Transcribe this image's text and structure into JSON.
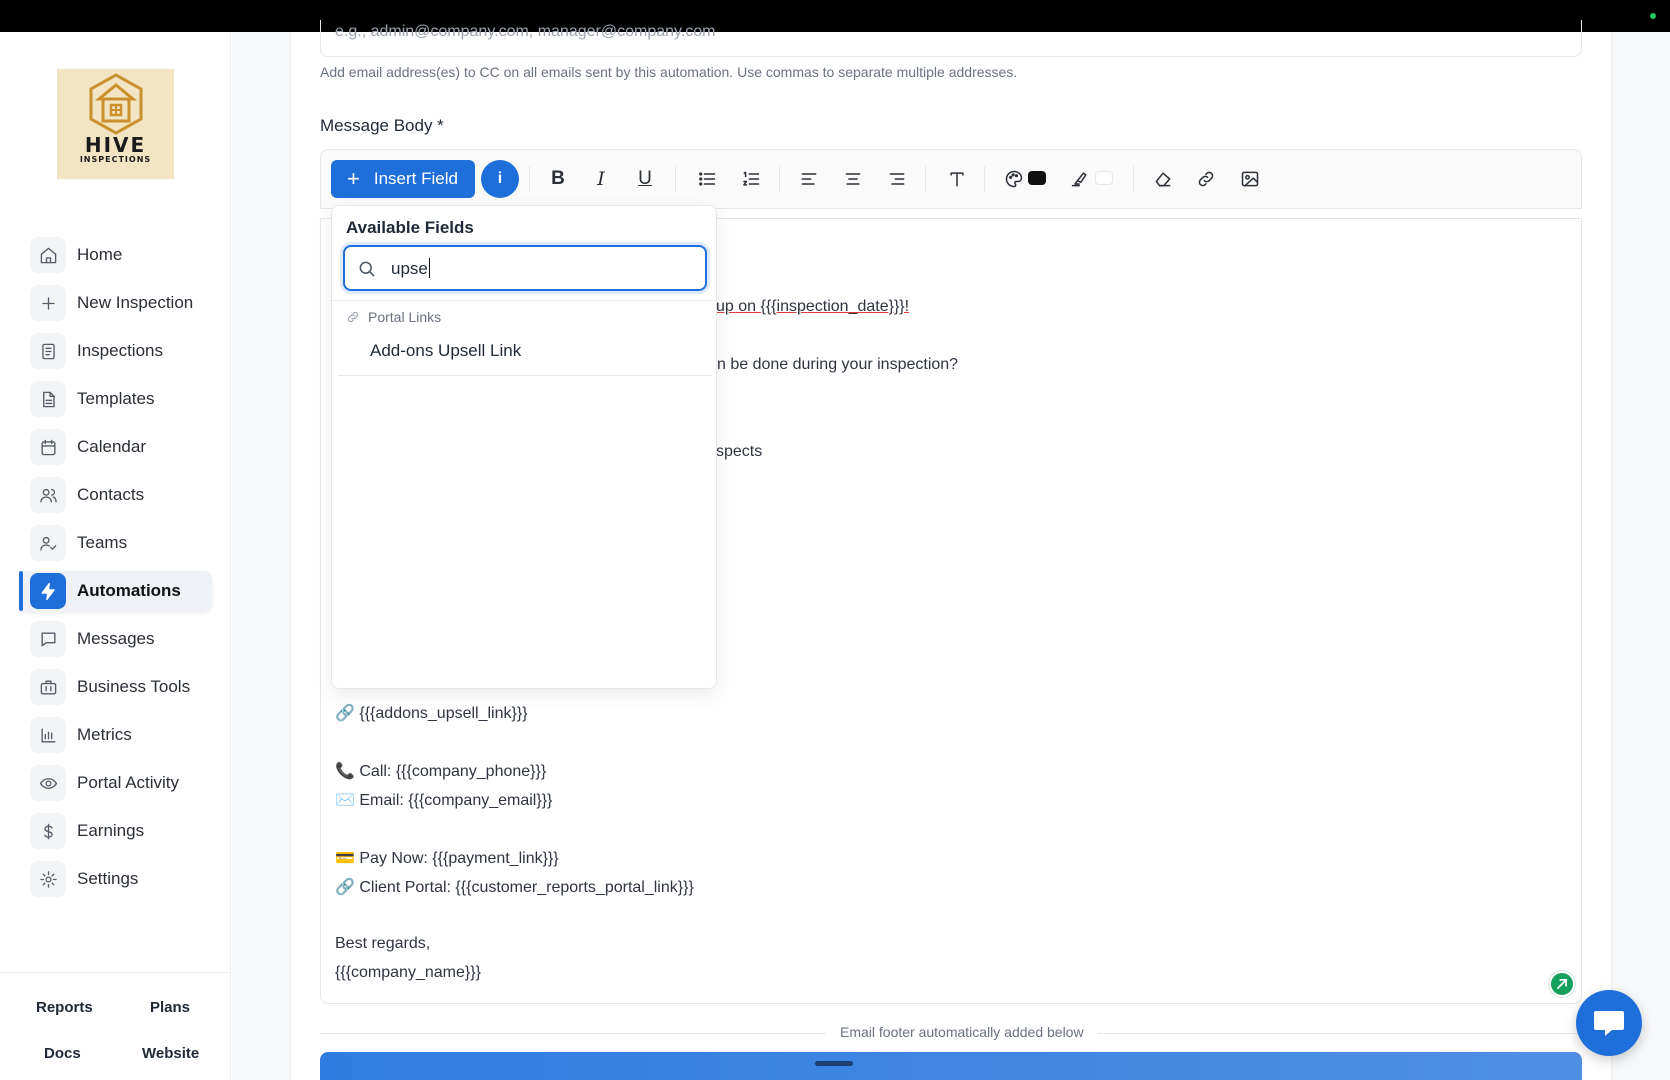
{
  "brand": {
    "logo_line1": "HIVE",
    "logo_line2": "INSPECTIONS"
  },
  "nav": {
    "items": [
      {
        "label": "Home",
        "icon": "home-icon"
      },
      {
        "label": "New Inspection",
        "icon": "plus-icon"
      },
      {
        "label": "Inspections",
        "icon": "inspections-icon"
      },
      {
        "label": "Templates",
        "icon": "document-icon"
      },
      {
        "label": "Calendar",
        "icon": "calendar-icon"
      },
      {
        "label": "Contacts",
        "icon": "contacts-icon"
      },
      {
        "label": "Teams",
        "icon": "teams-icon"
      },
      {
        "label": "Automations",
        "icon": "lightning-icon",
        "active": true
      },
      {
        "label": "Messages",
        "icon": "message-icon"
      },
      {
        "label": "Business Tools",
        "icon": "briefcase-icon"
      },
      {
        "label": "Metrics",
        "icon": "bar-chart-icon"
      },
      {
        "label": "Portal Activity",
        "icon": "eye-icon"
      },
      {
        "label": "Earnings",
        "icon": "dollar-icon"
      },
      {
        "label": "Settings",
        "icon": "gear-icon"
      }
    ],
    "footer": {
      "reports": "Reports",
      "plans": "Plans",
      "docs": "Docs",
      "website": "Website"
    }
  },
  "form": {
    "cc_placeholder": "e.g., admin@company.com, manager@company.com",
    "cc_help": "Add email address(es) to CC on all emails sent by this automation. Use commas to separate multiple addresses.",
    "message_body_label": "Message Body *",
    "insert_field_label": "Insert Field",
    "info_label": "i",
    "text_color": "#111111",
    "highlight_color": "#ffffff",
    "footer_note": "Email footer automatically added below"
  },
  "editor_lines": {
    "l1": "up on {{{inspection_date}}}!",
    "l2": "n be done during your inspection?",
    "l3": "spects",
    "l4": "🔗 {{{addons_upsell_link}}}",
    "l5": "📞 Call: {{{company_phone}}}",
    "l6": "✉️ Email: {{{company_email}}}",
    "l7": "💳 Pay Now: {{{payment_link}}}",
    "l8": "🔗 Client Portal: {{{customer_reports_portal_link}}}",
    "l9": "Best regards,",
    "l10": "{{{company_name}}}"
  },
  "dropdown": {
    "title": "Available Fields",
    "search_value": "upse",
    "category": "Portal Links",
    "item": "Add-ons Upsell Link"
  }
}
